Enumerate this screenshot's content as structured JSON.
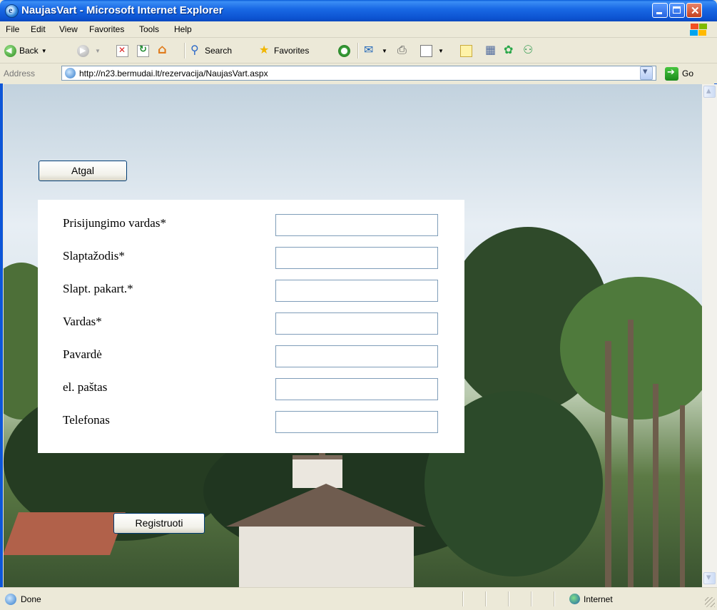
{
  "window": {
    "title": "NaujasVart - Microsoft Internet Explorer",
    "title_icon": "ie-icon",
    "buttons": [
      "minimize-icon",
      "maximize-icon",
      "close-icon"
    ]
  },
  "menu": {
    "items": [
      "File",
      "Edit",
      "View",
      "Favorites",
      "Tools",
      "Help"
    ]
  },
  "toolbar": {
    "back_label": "Back",
    "search_label": "Search",
    "favorites_label": "Favorites"
  },
  "address": {
    "label": "Address",
    "url": "http://n23.bermudai.lt/rezervacija/NaujasVart.aspx",
    "go_label": "Go"
  },
  "page": {
    "back_button": "Atgal",
    "register_button": "Registruoti",
    "form": {
      "fields": [
        {
          "label": "Prisijungimo vardas*",
          "value": ""
        },
        {
          "label": "Slaptažodis*",
          "value": ""
        },
        {
          "label": "Slapt. pakart.*",
          "value": ""
        },
        {
          "label": "Vardas*",
          "value": ""
        },
        {
          "label": "Pavardė",
          "value": ""
        },
        {
          "label": "el. paštas",
          "value": ""
        },
        {
          "label": "Telefonas",
          "value": ""
        }
      ]
    }
  },
  "status": {
    "text": "Done",
    "zone": "Internet"
  },
  "colors": {
    "titlebar": "#0c53d1",
    "button_border": "#003c74",
    "input_border": "#7f9db9"
  }
}
